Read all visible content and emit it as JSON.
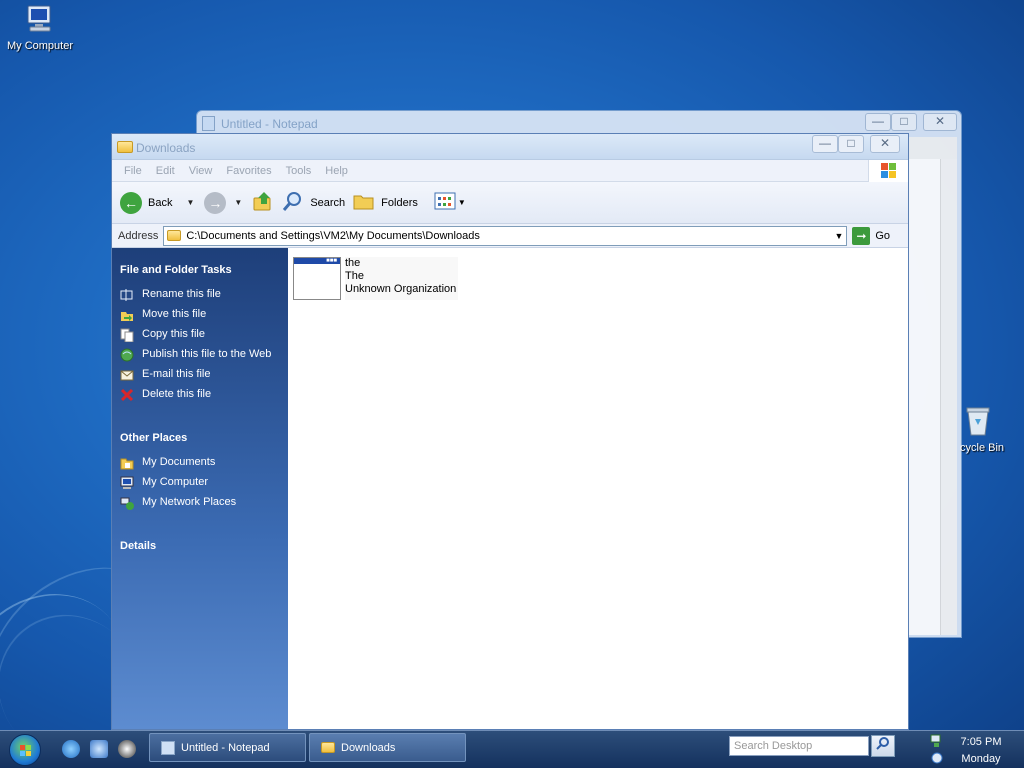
{
  "desktop": {
    "icons": [
      {
        "label": "My Computer",
        "icon": "computer-icon"
      },
      {
        "label": "cycle Bin",
        "icon": "recycle-bin-icon"
      }
    ]
  },
  "notepad_window": {
    "title": "Untitled - Notepad",
    "buttons": [
      "minimize",
      "maximize",
      "close"
    ]
  },
  "explorer_window": {
    "title": "Downloads",
    "menu": [
      "File",
      "Edit",
      "View",
      "Favorites",
      "Tools",
      "Help"
    ],
    "toolbar": {
      "back_label": "Back",
      "search_label": "Search",
      "folders_label": "Folders"
    },
    "address": {
      "label": "Address",
      "value": "C:\\Documents and Settings\\VM2\\My Documents\\Downloads",
      "go_label": "Go"
    },
    "task_pane": {
      "file_tasks": {
        "title": "File and Folder Tasks",
        "items": [
          {
            "label": "Rename this file",
            "icon": "rename-icon"
          },
          {
            "label": "Move this file",
            "icon": "move-icon"
          },
          {
            "label": "Copy this file",
            "icon": "copy-icon"
          },
          {
            "label": "Publish this file to the Web",
            "icon": "publish-web-icon"
          },
          {
            "label": "E-mail this file",
            "icon": "email-icon"
          },
          {
            "label": "Delete this file",
            "icon": "delete-icon"
          }
        ]
      },
      "other_places": {
        "title": "Other Places",
        "items": [
          {
            "label": "My Documents",
            "icon": "my-documents-icon"
          },
          {
            "label": "My Computer",
            "icon": "my-computer-icon"
          },
          {
            "label": "My Network Places",
            "icon": "network-places-icon"
          }
        ]
      },
      "details": {
        "title": "Details"
      }
    },
    "files": [
      {
        "line1": "the",
        "line2": "The",
        "line3": "Unknown Organization",
        "icon": "application-window-icon"
      }
    ]
  },
  "taskbar": {
    "tasks": [
      {
        "label": "Untitled - Notepad",
        "icon": "notepad-icon"
      },
      {
        "label": "Downloads",
        "icon": "folder-icon"
      }
    ],
    "search_placeholder": "Search Desktop",
    "clock": {
      "time": "7:05 PM",
      "day": "Monday"
    }
  },
  "colors": {
    "task_pane_top": "#1e3f7a",
    "task_pane_bottom": "#5d8cd0",
    "desktop_blue": "#1f6cc3"
  }
}
